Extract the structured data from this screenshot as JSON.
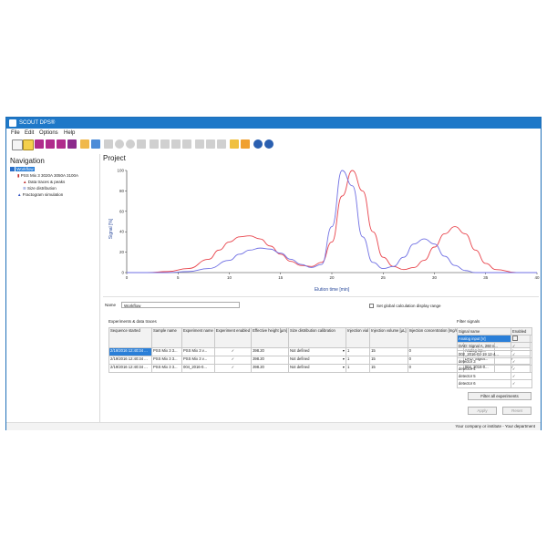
{
  "window": {
    "title": "SCOUT DPS®"
  },
  "menu": [
    "File",
    "Edit",
    "Options",
    "Help"
  ],
  "toolbar_icons": [
    "new-icon",
    "open-icon",
    "save-icon",
    "save-as-icon",
    "save-all-icon",
    "print-icon",
    "folder-icon",
    "import-icon",
    "first-icon",
    "prev-icon",
    "next-icon",
    "last-icon",
    "peak-icon",
    "peaks-icon",
    "flask-icon",
    "flasks-icon",
    "cut-icon",
    "copy-icon",
    "paste-icon",
    "ruler-icon",
    "triangle-icon",
    "info-icon",
    "help-icon"
  ],
  "navigation": {
    "header": "Navigation",
    "items": [
      {
        "label": "Workflow",
        "selected": true
      },
      {
        "label": "PSS Mix 3 3020A 3050A 3100A"
      },
      {
        "label": "Data traces & peaks"
      },
      {
        "label": "Size distribution"
      },
      {
        "label": "Fractogram simulation"
      }
    ]
  },
  "project": {
    "header": "Project"
  },
  "chart_data": {
    "type": "line",
    "xlabel": "Elution time [min]",
    "ylabel": "Signal [%]",
    "xlim": [
      0,
      40
    ],
    "ylim": [
      0,
      100
    ],
    "xticks": [
      0,
      5,
      10,
      15,
      20,
      25,
      30,
      35,
      40
    ],
    "yticks": [
      0,
      20,
      40,
      60,
      80,
      100
    ],
    "grid": false,
    "series": [
      {
        "color": "#e8434b",
        "x": [
          0,
          2,
          4,
          6,
          8,
          9,
          10,
          11,
          12,
          13,
          14,
          15,
          16,
          17,
          18,
          19,
          20,
          21,
          22,
          23,
          24,
          25,
          26,
          27,
          28,
          29,
          30,
          31,
          32,
          33,
          34,
          35,
          36,
          38,
          40
        ],
        "values": [
          0,
          0,
          1,
          4,
          13,
          22,
          30,
          35,
          36,
          33,
          26,
          18,
          11,
          7,
          6,
          10,
          30,
          75,
          100,
          80,
          40,
          15,
          6,
          3,
          5,
          12,
          25,
          38,
          45,
          38,
          22,
          9,
          3,
          0,
          0
        ]
      },
      {
        "color": "#6f6fe3",
        "x": [
          0,
          2,
          4,
          6,
          8,
          10,
          11,
          12,
          13,
          14,
          15,
          16,
          17,
          18,
          19,
          20,
          21,
          22,
          23,
          24,
          25,
          26,
          27,
          28,
          29,
          30,
          31,
          32,
          33,
          34,
          36,
          38,
          40
        ],
        "values": [
          0,
          0,
          0,
          1,
          4,
          12,
          18,
          22,
          24,
          23,
          19,
          13,
          8,
          5,
          8,
          45,
          100,
          85,
          35,
          10,
          4,
          6,
          15,
          28,
          33,
          28,
          16,
          7,
          2,
          0,
          0,
          0,
          0
        ]
      }
    ]
  },
  "form": {
    "name_label": "Name",
    "name_value": "Workflow",
    "global_calc_label": "Set global calculation display range",
    "experiments_title": "Experiments & data traces",
    "filter_title": "Filter signals",
    "columns": [
      "Sequence started",
      "Sample name",
      "Experiment name",
      "Experiment enabled",
      "Effective height [µm]",
      "Size distribution calibration",
      "Injection vial",
      "Injection volume [µL]",
      "Injection concentration [mg/mL]",
      "Data trace signal",
      "Data trace enabled"
    ],
    "rows": [
      [
        "2/19/2016 12:40:34 ...",
        "PSS Mix 3 3...",
        "PSS Mix 3 v...",
        "✓",
        "398.20",
        "Not defined",
        "1",
        "15",
        "0",
        "Analog inp...",
        "✓"
      ],
      [
        "2/19/2016 12:40:34 ...",
        "PSS Mix 3 3...",
        "PSS Mix 3 v...",
        "✓",
        "398.20",
        "Not defined",
        "1",
        "15",
        "0",
        "DAD: Signa...",
        "✓"
      ],
      [
        "2/19/2016 12:40:34 ...",
        "PSS Mix 3 3...",
        "004_2016-0...",
        "✓",
        "398.20",
        "Not defined",
        "1",
        "15",
        "0",
        "004_2016-0...",
        "✓"
      ]
    ],
    "signal_columns": [
      "Signal name",
      "Enabled"
    ],
    "signals": [
      {
        "name": "Analog input [V]",
        "enabled": false,
        "selected": true
      },
      {
        "name": "DAD: Signal A, 260 n...",
        "enabled": true
      },
      {
        "name": "002_2016-02-19 12-4...",
        "enabled": true
      },
      {
        "name": "detector 3",
        "enabled": true
      },
      {
        "name": "detector 4",
        "enabled": true
      },
      {
        "name": "detector 5",
        "enabled": true
      },
      {
        "name": "detector 6",
        "enabled": true
      }
    ],
    "filter_all_label": "Filter all experiments",
    "apply_label": "Apply",
    "reset_label": "Reset"
  },
  "status": {
    "text": "Your company or institute - Your department"
  }
}
